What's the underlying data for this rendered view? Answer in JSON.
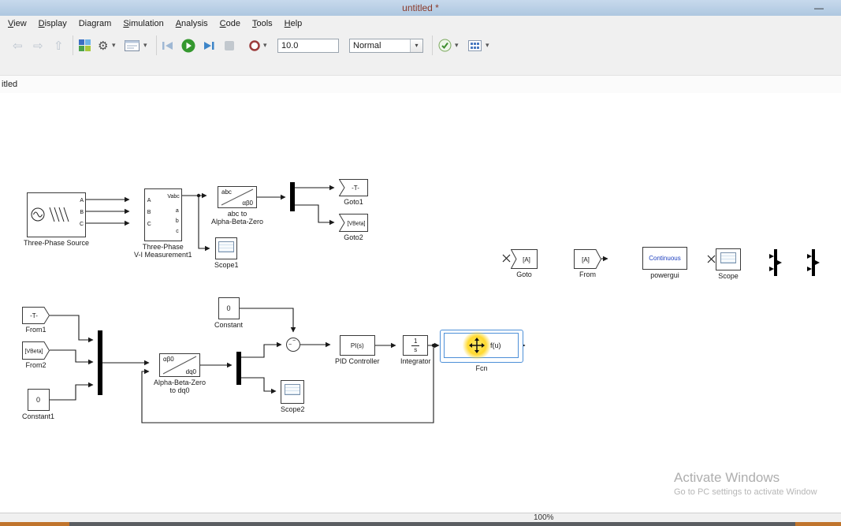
{
  "titlebar": {
    "title": "untitled *",
    "minimize_glyph": "—"
  },
  "menubar": {
    "items": [
      "View",
      "Display",
      "Diagram",
      "Simulation",
      "Analysis",
      "Code",
      "Tools",
      "Help"
    ]
  },
  "toolbar": {
    "back_glyph": "⇦",
    "forward_glyph": "⇨",
    "up_glyph": "⇧",
    "gear_glyph": "⚙",
    "dropdown_glyph": "▾",
    "check_glyph": "✓",
    "sim_stop_time": "10.0",
    "sim_mode": "Normal"
  },
  "tabbar": {
    "tab_label": "itled"
  },
  "blocks": {
    "three_phase_source": {
      "label": "Three-Phase Source",
      "port_a": "A",
      "port_b": "B",
      "port_c": "C"
    },
    "vi_measurement": {
      "label_line1": "Three-Phase",
      "label_line2": "V-I Measurement1",
      "in_a": "A",
      "in_b": "B",
      "in_c": "C",
      "out_top": "Vabc",
      "out_a": "a",
      "out_b": "b",
      "out_c": "c"
    },
    "abc_to_ab0": {
      "text_top": "abc",
      "text_bottom": "αβ0",
      "label_line1": "abc to",
      "label_line2": "Alpha-Beta-Zero"
    },
    "goto1": {
      "tag": "-T-",
      "label": "Goto1"
    },
    "goto2": {
      "tag": "[VBeta]",
      "label": "Goto2"
    },
    "scope1": {
      "label": "Scope1"
    },
    "goto_a": {
      "tag": "[A]",
      "label": "Goto"
    },
    "from_a": {
      "tag": "[A]",
      "label": "From"
    },
    "powergui": {
      "text": "Continuous",
      "label": "powergui"
    },
    "scope_tr": {
      "label": "Scope"
    },
    "from1": {
      "tag": "-T-",
      "label": "From1"
    },
    "from2": {
      "tag": "[VBeta]",
      "label": "From2"
    },
    "constant1": {
      "value": "0",
      "label": "Constant1"
    },
    "ab0_to_dq0": {
      "text_top": "αβ0",
      "text_bottom": "dq0",
      "label_line1": "Alpha-Beta-Zero",
      "label_line2": "to dq0"
    },
    "constant": {
      "value": "0",
      "label": "Constant"
    },
    "sum": {
      "sign1": "−",
      "sign2": "−"
    },
    "pid": {
      "text": "PI(s)",
      "label": "PID Controller"
    },
    "integrator": {
      "num": "1",
      "den": "s",
      "label": "Integrator"
    },
    "fcn": {
      "text": "f(u)",
      "label": "Fcn"
    },
    "scope2": {
      "label": "Scope2"
    }
  },
  "statusbar": {
    "zoom": "100%"
  },
  "watermark": {
    "line1": "Activate Windows",
    "line2": "Go to PC settings to activate Window"
  }
}
